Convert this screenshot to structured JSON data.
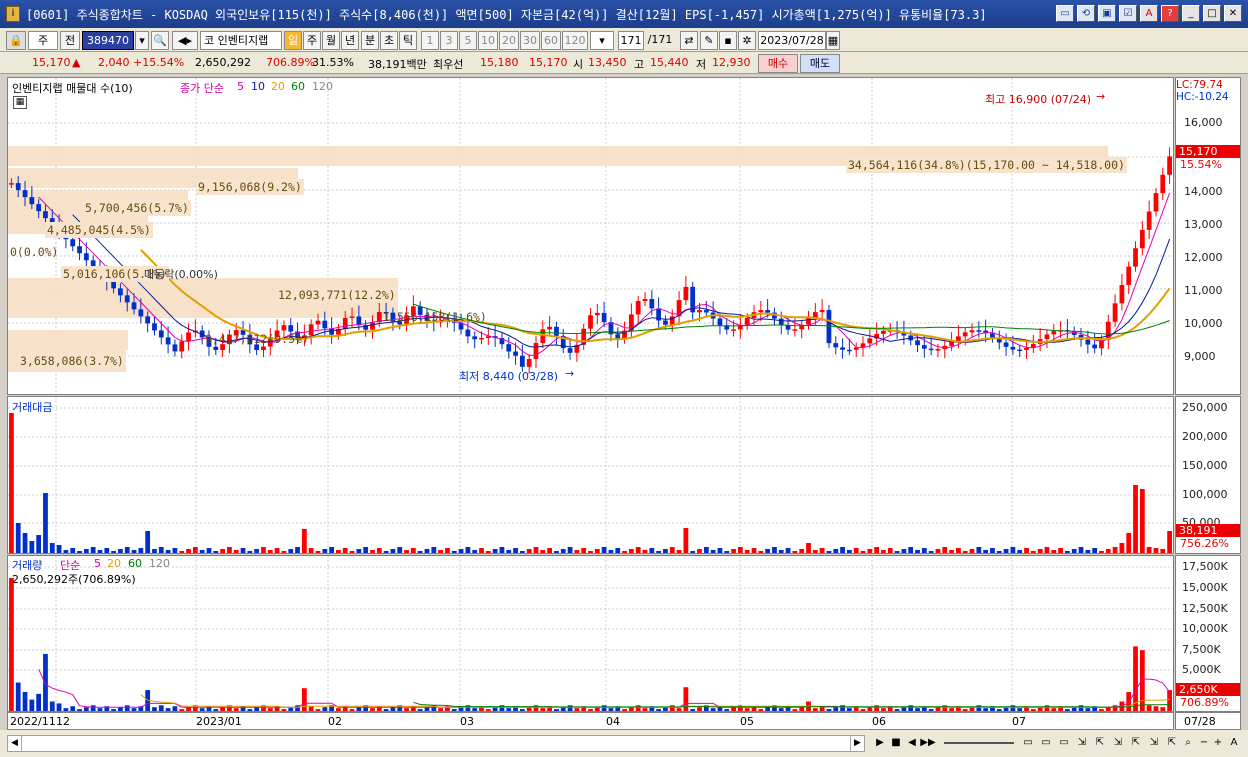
{
  "window": {
    "title": "[0601] 주식종합차트 - KOSDAQ 외국인보유[115(천)] 주식수[8,406(천)] 액면[500] 자본금[42(억)] 결산[12월] EPS[-1,457] 시가총액[1,275(억)] 유통비율[73.3]",
    "controls": [
      "▭",
      "⟲",
      "▣",
      "☑",
      "A",
      "?",
      "_",
      "□",
      "✕"
    ]
  },
  "toolbar": {
    "market_select": "주",
    "prev_label": "전",
    "code": "389470",
    "search_glyph": "🔍",
    "speaker_glyph": "◀▸",
    "stock_name": "코 인벤티지랩",
    "periods": [
      "일",
      "주",
      "월",
      "년",
      "분",
      "초",
      "틱"
    ],
    "active_period": "일",
    "intervals": [
      "1",
      "3",
      "5",
      "10",
      "20",
      "30",
      "60",
      "120"
    ],
    "count_value": "171",
    "count_total": "/171",
    "date": "2023/07/28"
  },
  "quote": {
    "price": "15,170",
    "change_arrow": "▲",
    "change": "2,040",
    "change_pct": "+15.54%",
    "volume": "2,650,292",
    "volume_ratio": "706.89%",
    "turnover": "31.53%",
    "amount": "38,191백만",
    "best_label": "최우선",
    "best_ask": "15,180",
    "best_bid": "15,170",
    "open_label": "시",
    "open": "13,450",
    "high_label": "고",
    "high": "15,440",
    "low_label": "저",
    "low": "12,930",
    "buy_label": "매수",
    "sell_label": "매도"
  },
  "price_panel": {
    "title": "인벤티지랩 매물대 수(10)",
    "ma_label": "종가 단순",
    "ma_periods": [
      "5",
      "10",
      "20",
      "60",
      "120"
    ],
    "lc": "LC:79.74",
    "hc": "HC:-10.24",
    "max_label": "최고 16,900 (07/24)",
    "min_label": "최저 8,440 (03/28)",
    "current_tag": "15,170",
    "current_pct": "15.54%",
    "y_ticks": [
      "16,000",
      "15,000",
      "14,000",
      "13,000",
      "12,000",
      "11,000",
      "10,000",
      "9,000"
    ],
    "volume_profile": [
      {
        "label": "34,564,116(34.8%)(15,170.00 ~ 14,518.00)"
      },
      {
        "label": "9,156,068(9.2%)"
      },
      {
        "label": "5,700,456(5.7%)"
      },
      {
        "label": "4,485,045(4.5%)"
      },
      {
        "label": "0(0.0%)"
      },
      {
        "label": "5,016,106(5.1%)"
      },
      {
        "label": "12,093,771(12.2%)"
      },
      {
        "label": "9,417,612(9.5%)"
      },
      {
        "label": "3,658,086(3.7%)"
      },
      {
        "label": "1,556,158(1.6%)"
      }
    ],
    "stop_label": "매동락(0.00%)"
  },
  "amount_panel": {
    "title": "거래대금",
    "y_ticks": [
      "250,000",
      "200,000",
      "150,000",
      "100,000",
      "50,000"
    ],
    "current_tag": "38,191",
    "current_pct": "756.26%"
  },
  "volume_panel": {
    "title": "거래량",
    "ma_label": "단순",
    "ma_periods": [
      "5",
      "20",
      "60",
      "120"
    ],
    "current_text": "2,650,292주(706.89%)",
    "y_ticks": [
      "17,500K",
      "15,000K",
      "12,500K",
      "10,000K",
      "7,500K",
      "5,000K"
    ],
    "current_tag": "2,650K",
    "current_pct": "706.89%"
  },
  "x_axis": {
    "labels": [
      "2022/11",
      "12",
      "2023/01",
      "02",
      "03",
      "04",
      "05",
      "06",
      "07"
    ],
    "right_label": "07/28"
  },
  "colors": {
    "up": "#ff0000",
    "down": "#0030c8",
    "ma5": "#e000c0",
    "ma10": "#0a1a9a",
    "ma20": "#e0a000",
    "ma60": "#008000",
    "title_bar": "#2a52a8"
  }
}
